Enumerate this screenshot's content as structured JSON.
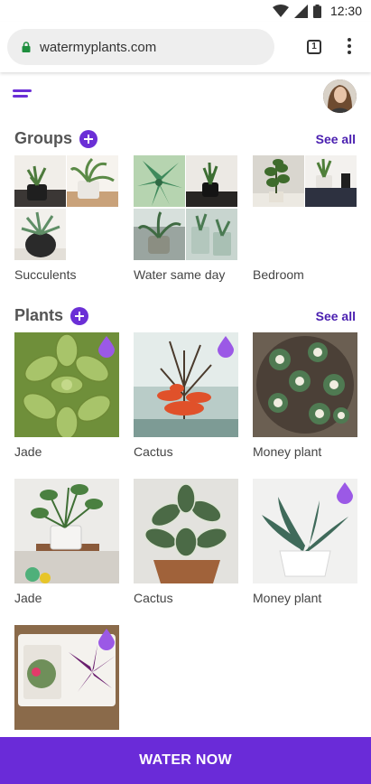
{
  "status_bar": {
    "time": "12:30"
  },
  "browser": {
    "url": "watermyplants.com",
    "tab_count": "1"
  },
  "groups": {
    "title": "Groups",
    "see_all": "See all",
    "items": [
      {
        "label": "Succulents"
      },
      {
        "label": "Water same day"
      },
      {
        "label": "Bedroom"
      }
    ]
  },
  "plants": {
    "title": "Plants",
    "see_all": "See all",
    "items": [
      {
        "label": "Jade",
        "needs_water": true
      },
      {
        "label": "Cactus",
        "needs_water": true
      },
      {
        "label": "Money plant",
        "needs_water": false
      },
      {
        "label": "Jade",
        "needs_water": false
      },
      {
        "label": "Cactus",
        "needs_water": false
      },
      {
        "label": "Money plant",
        "needs_water": true
      },
      {
        "label": "",
        "needs_water": true
      }
    ]
  },
  "action": {
    "water_now": "WATER NOW"
  },
  "colors": {
    "accent": "#6b2fd6",
    "drop": "#9b59e6",
    "button": "#6a2bd8"
  }
}
